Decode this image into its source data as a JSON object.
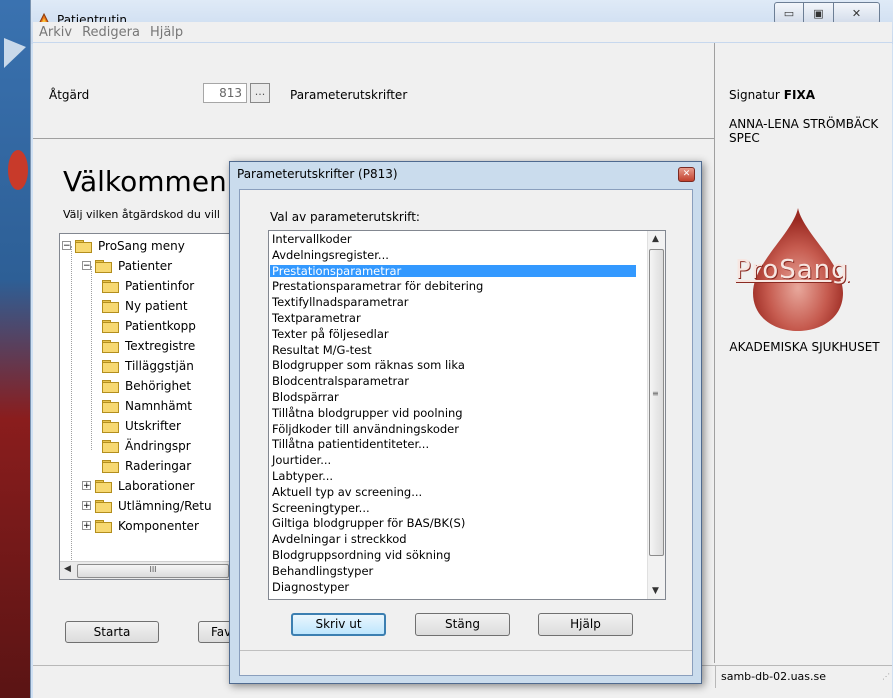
{
  "window": {
    "title": "Patientrutin",
    "controls": {
      "minimize": "▭",
      "maximize": "▣",
      "close": "✕"
    }
  },
  "menubar": {
    "items": [
      "Arkiv",
      "Redigera",
      "Hjälp"
    ]
  },
  "header": {
    "atgard_label": "Åtgärd",
    "code_value": "813",
    "browse_label": "...",
    "description": "Parameterutskrifter"
  },
  "main": {
    "welcome": "Välkommen t",
    "instruction": "Välj vilken åtgärdskod du vill"
  },
  "tree": {
    "root": "ProSang meny",
    "patienter": "Patienter",
    "patienter_children": [
      "Patientinfor",
      "Ny patient",
      "Patientkopp",
      "Textregistre",
      "Tilläggstjän",
      "Behörighet",
      "Namnhämt",
      "Utskrifter",
      "Ändringspr",
      "Raderingar"
    ],
    "laborationer": "Laborationer",
    "utlamning": "Utlämning/Retu",
    "komponenter": "Komponenter",
    "scroll_grip": "III"
  },
  "buttons": {
    "starta": "Starta",
    "fav": "Fav"
  },
  "right_panel": {
    "signatur_label": "Signatur",
    "signatur_value": "FIXA",
    "user_name": "ANNA-LENA STRÖMBÄCK SPEC",
    "logo_text": "ProSang",
    "hospital": "AKADEMISKA SJUKHUSET"
  },
  "statusbar": {
    "server": "samb-db-02.uas.se"
  },
  "dialog": {
    "title": "Parameterutskrifter (P813)",
    "close": "✕",
    "label": "Val av parameterutskrift:",
    "items": [
      "Intervallkoder",
      "Avdelningsregister...",
      "Prestationsparametrar",
      "Prestationsparametrar för debitering",
      "Textifyllnadsparametrar",
      "Textparametrar",
      "Texter på följesedlar",
      "Resultat M/G-test",
      "Blodgrupper som räknas som lika",
      "Blodcentralsparametrar",
      "Blodspärrar",
      "Tillåtna blodgrupper vid poolning",
      "Följdkoder till användningskoder",
      "Tillåtna patientidentiteter...",
      "Jourtider...",
      "Labtyper...",
      "Aktuell typ av screening...",
      "Screeningtyper...",
      "Giltiga blodgrupper för BAS/BK(S)",
      "Avdelningar i streckkod",
      "Blodgruppsordning vid sökning",
      "Behandlingstyper",
      "Diagnostyper"
    ],
    "selected_index": 2,
    "buttons": {
      "print": "Skriv ut",
      "close": "Stäng",
      "help": "Hjälp"
    },
    "scroll_grip": "≡"
  },
  "colors": {
    "selection": "#3399ff",
    "title_bg": "#cadced",
    "logo_red": "#b52c25"
  }
}
